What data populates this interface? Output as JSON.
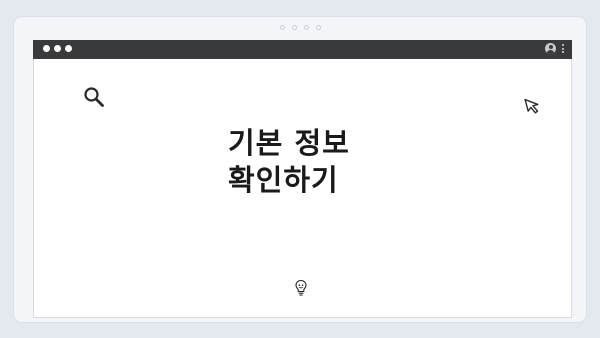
{
  "headline": {
    "line1": "기본 정보",
    "line2": "확인하기"
  },
  "icons": {
    "search": "search-icon",
    "cursor": "cursor-arrow-icon",
    "lightbulb": "lightbulb-icon",
    "user": "user-icon",
    "more": "more-vert-icon"
  },
  "colors": {
    "background": "#e4e9f0",
    "titlebar": "#3a3a3c",
    "headline": "#1a1a1a"
  }
}
